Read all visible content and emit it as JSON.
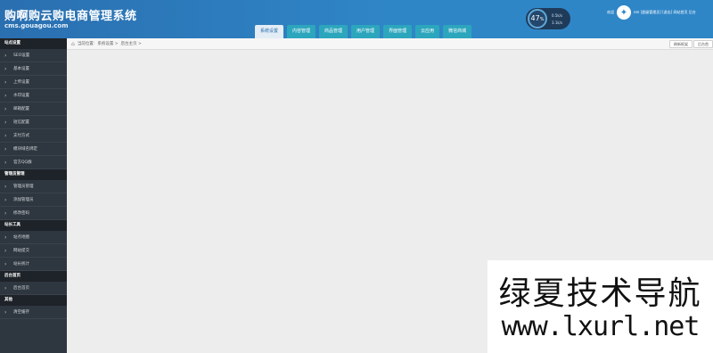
{
  "header": {
    "title": "购啊购云购电商管理系统",
    "subtitle": "cms.gouagou.com"
  },
  "topnav": {
    "tabs": [
      {
        "label": "系统设置",
        "active": true
      },
      {
        "label": "内容管理",
        "active": false
      },
      {
        "label": "商品管理",
        "active": false
      },
      {
        "label": "用户管理",
        "active": false
      },
      {
        "label": "界面管理",
        "active": false
      },
      {
        "label": "云应用",
        "active": false
      },
      {
        "label": "微信商城",
        "active": false
      }
    ]
  },
  "gauge": {
    "value": "47",
    "unit": "%",
    "line1": "0.5k/s",
    "line2": "3.1k/s"
  },
  "user": {
    "welcome": "欢迎",
    "info": "nm [超级管理员] [退出]  网站首页  后台"
  },
  "sidebar": {
    "sections": [
      {
        "title": "站点设置",
        "items": [
          "SEO设置",
          "基本设置",
          "上传设置",
          "水印设置",
          "邮箱配置",
          "短信配置",
          "支付方式",
          "模块域名绑定",
          "官方QQ群"
        ]
      },
      {
        "title": "管理员管理",
        "items": [
          "管理员管理",
          "添加管理员",
          "修改密码"
        ]
      },
      {
        "title": "站长工具",
        "items": [
          "站点地图",
          "网站提交",
          "站长统计"
        ]
      },
      {
        "title": "后台首页",
        "items": [
          "后台首页"
        ]
      },
      {
        "title": "其他",
        "items": [
          "清空缓存"
        ]
      }
    ]
  },
  "breadcrumb": {
    "label": "当前位置:",
    "path": "系统设置 >",
    "current": "后台主页 >"
  },
  "actions": {
    "refresh": "刷新框架",
    "back": "后台首"
  },
  "watermark": {
    "cn": "绿夏技术导航",
    "url": "www.lxurl.net"
  },
  "colors": {
    "header": "#2f86c7",
    "sidebar": "#2e363f",
    "tab": "#2ca6bd"
  }
}
